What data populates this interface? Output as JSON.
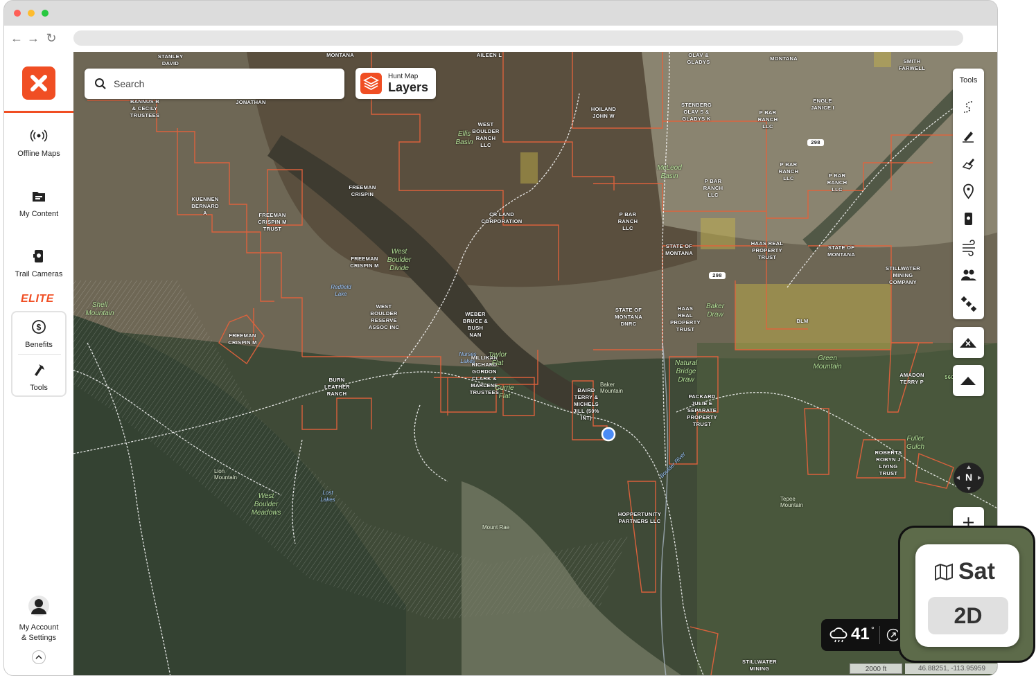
{
  "sidebar": {
    "offline_maps": "Offline Maps",
    "my_content": "My Content",
    "trail_cameras": "Trail Cameras",
    "elite": "ELITE",
    "benefits": "Benefits",
    "tools": "Tools",
    "account_line1": "My Account",
    "account_line2": "& Settings"
  },
  "search": {
    "placeholder": "Search"
  },
  "layers": {
    "small": "Hunt Map",
    "big": "Layers"
  },
  "tools_panel": {
    "title": "Tools"
  },
  "compass": {
    "label": "N"
  },
  "weather": {
    "temp": "41",
    "unit": "°"
  },
  "scale": {
    "label": "2000 ft"
  },
  "coords": {
    "label": "46.88251, -113.95959"
  },
  "overlay": {
    "sat_label": "Sat",
    "mode_label": "2D"
  },
  "map_labels": [
    "STANLEY DAVID",
    "MONTANA",
    "AILEEN L",
    "OLAV & GLADYS",
    "MONTANA",
    "SMITH FARWELL",
    "BANNUS B & CECILY TRUSTEES",
    "JONATHAN",
    "HOILAND JOHN W",
    "STENBERG OLAV S & GLADYS K",
    "P BAR RANCH LLC",
    "ENGLE JANICE I",
    "WEST BOULDER RANCH LLC",
    "P BAR RANCH LLC",
    "P BAR RANCH LLC",
    "P BAR RANCH LLC",
    "FREEMAN CRISPIN",
    "KUENNEN BERNARD A",
    "FREEMAN CRISPIN M TRUST",
    "CR LAND CORPORATION",
    "P BAR RANCH LLC",
    "STATE OF MONTANA",
    "HAAS REAL PROPERTY TRUST",
    "STATE OF MONTANA",
    "STILLWATER MINING COMPANY",
    "FREEMAN CRISPIN M",
    "WEST BOULDER RESERVE ASSOC INC",
    "WEBER BRUCE & BUSH NAN",
    "STATE OF MONTANA DNRC",
    "HAAS REAL PROPERTY TRUST",
    "BLM",
    "FREEMAN CRISPIN M",
    "BURN LEATHER RANCH",
    "MILLIKAN RICHARD GORDON CLARK & MARLENE TRUSTEES",
    "BAIRD TERRY & MICHELS JILL (50% INT)",
    "PACKARD JULIE E SEPARATE PROPERTY TRUST",
    "AMADON TERRY P",
    "ROBERTS ROBYN J LIVING TRUST",
    "HOPPERTUNITY PARTNERS LLC",
    "STILLWATER MINING"
  ],
  "terrain_labels": [
    "Ellis Basin",
    "McLeod Basin",
    "West Boulder Divide",
    "Shell Mountain",
    "Taylor Flat",
    "Currie Flat",
    "Natural Bridge Draw",
    "Baker Draw",
    "Green Mountain",
    "Fuller Gulch",
    "West Boulder Meadows"
  ],
  "water_labels": [
    "Redfield Lake",
    "Nurses Lakes",
    "Lost Lakes",
    "Boulder River"
  ],
  "peak_labels": [
    "Baker Mountain",
    "Lion Mountain",
    "Mount Rae",
    "Tepee Mountain"
  ],
  "road_labels": [
    "298",
    "298",
    "560"
  ]
}
